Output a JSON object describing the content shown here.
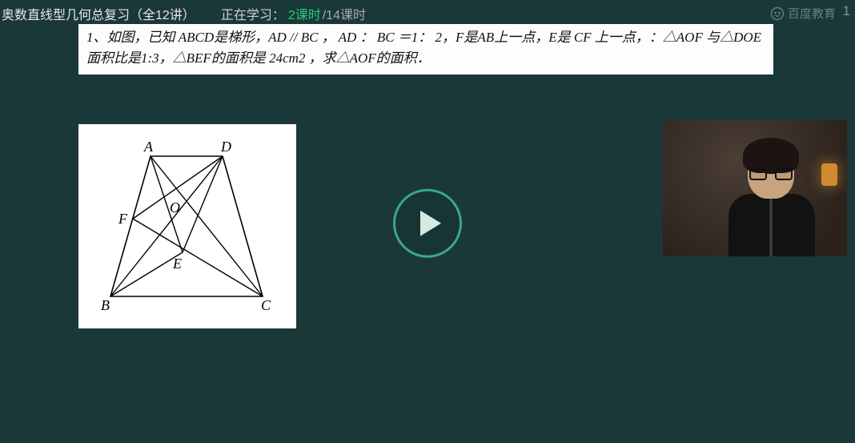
{
  "header": {
    "course_title": "奥数直线型几何总复习（全12讲）",
    "status_label": "正在学习：",
    "current_lesson": "2课时",
    "total_lesson": "/14课时",
    "brand_text": "百度教育",
    "brand_right_num": "1"
  },
  "problem": {
    "text": "1、如图，已知 ABCD是梯形，AD // BC ， AD ： BC ＝1： 2，F是AB上一点，E是 CF 上一点，：△AOF 与△DOE 面积比是1:3，△BEF的面积是 24cm2 ，求△AOF的面积．"
  },
  "diagram": {
    "labels": {
      "A": "A",
      "B": "B",
      "C": "C",
      "D": "D",
      "E": "E",
      "F": "F",
      "O": "O"
    }
  },
  "play": {
    "aria": "play-video"
  }
}
